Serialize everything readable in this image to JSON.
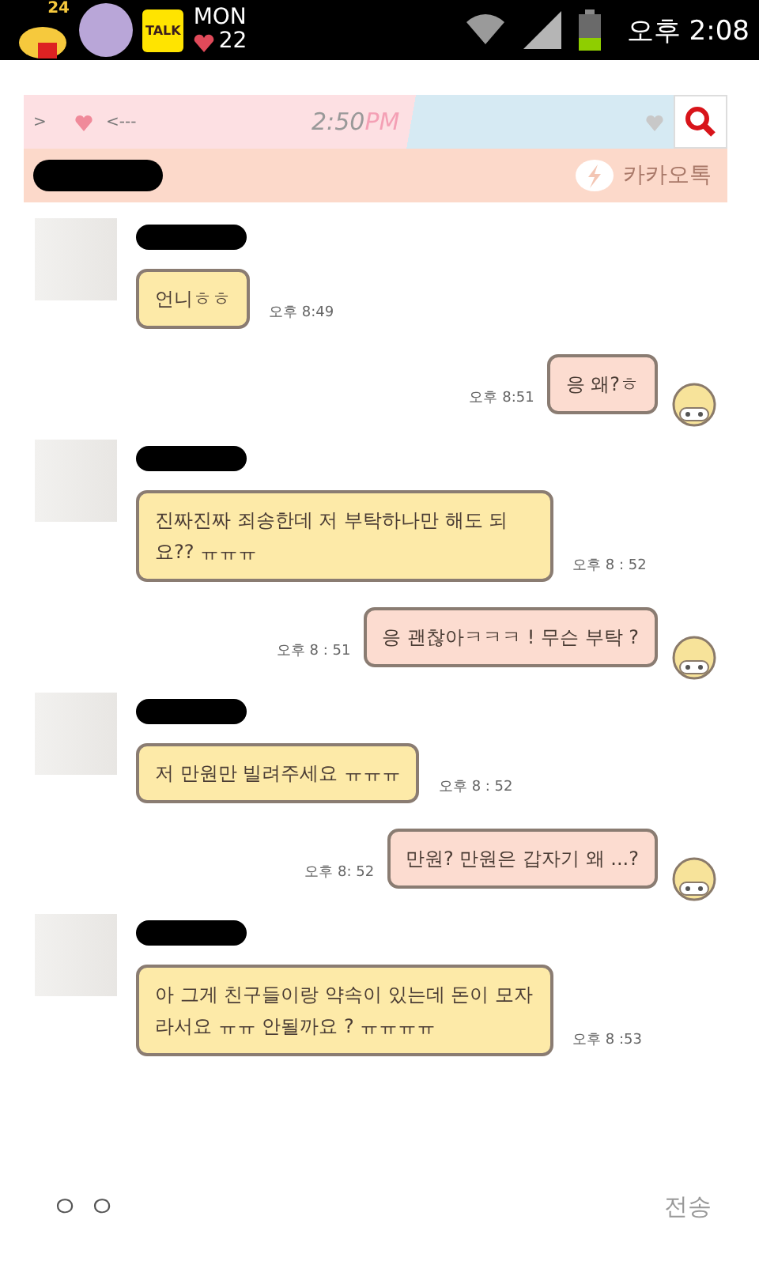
{
  "status_bar": {
    "badge": "24",
    "app_icon": "TALK",
    "day": "MON",
    "heart_count": "22",
    "time": "오후 2:08"
  },
  "theme_bar": {
    "back": ">",
    "arrow": "<---",
    "clock": "2:50",
    "clock_suffix": "PM"
  },
  "chat_header": {
    "app_name": "카카오톡"
  },
  "messages": [
    {
      "kind": "incoming",
      "text": "언니ㅎㅎ",
      "time": "오후 8:49"
    },
    {
      "kind": "outgoing",
      "text": "응 왜?ㅎ",
      "time": "오후 8:51"
    },
    {
      "kind": "incoming",
      "text": "진짜진짜 죄송한데 저 부탁하나만 해도 되요?? ㅠㅠㅠ",
      "time": "오후 8 : 52"
    },
    {
      "kind": "outgoing",
      "text": "응 괜찮아ㅋㅋㅋ ! 무슨 부탁 ?",
      "time": "오후 8 : 51"
    },
    {
      "kind": "incoming",
      "text": "저 만원만 빌려주세요 ㅠㅠㅠ",
      "time": "오후 8 : 52"
    },
    {
      "kind": "outgoing",
      "text": "만원? 만원은 갑자기 왜 ...?",
      "time": "오후 8: 52"
    },
    {
      "kind": "incoming",
      "text": "아 그게 친구들이랑 약속이 있는데 돈이 모자라서요 ㅠㅠ 안될까요 ? ㅠㅠㅠㅠ",
      "time": "오후 8 :53"
    }
  ],
  "composer": {
    "value": "ㅇ ㅇ",
    "send": "전송"
  }
}
